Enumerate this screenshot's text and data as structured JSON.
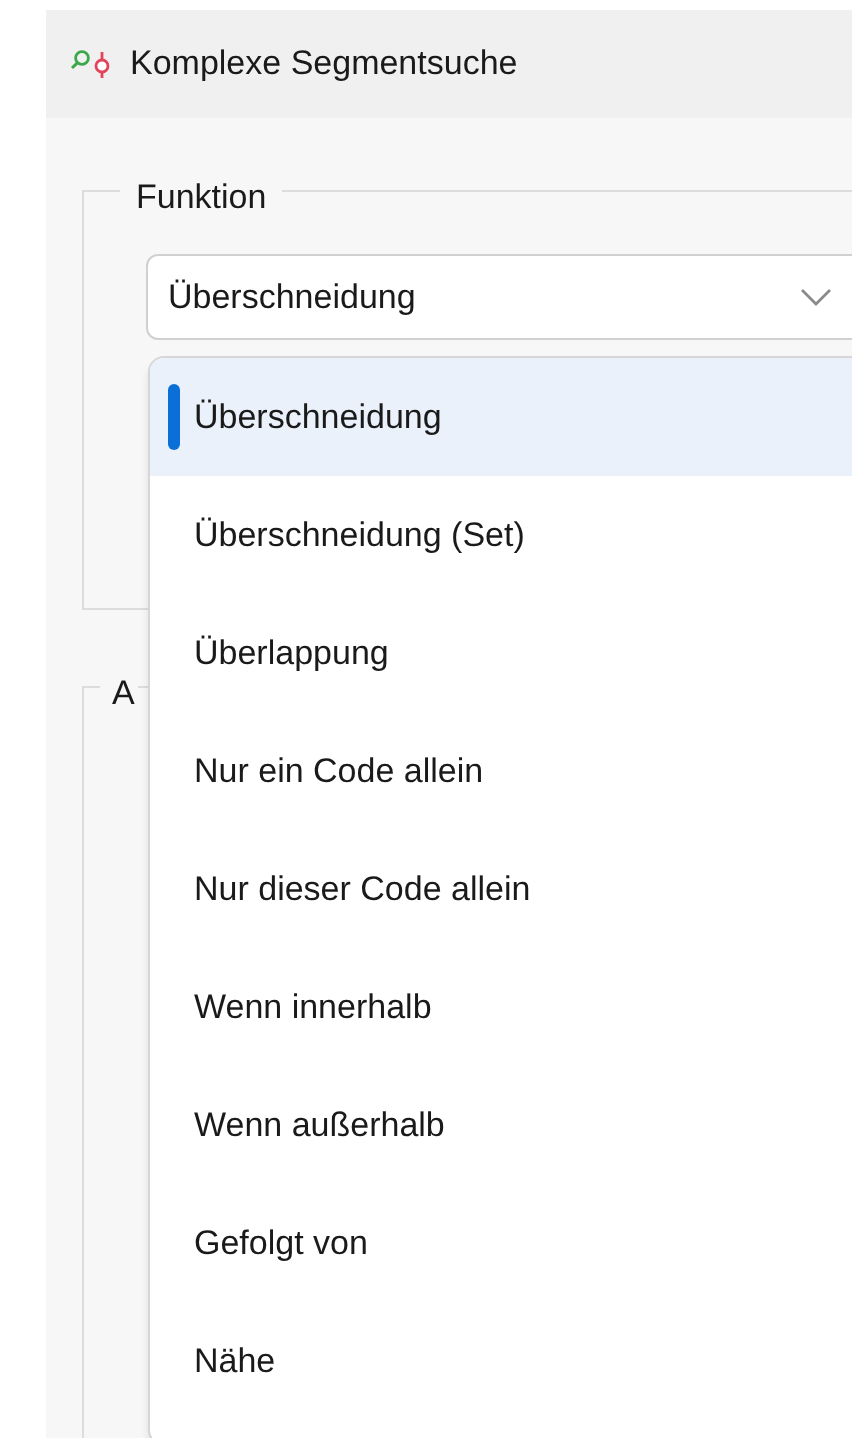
{
  "window": {
    "title": "Komplexe Segmentsuche"
  },
  "function_group": {
    "label": "Funktion",
    "combobox": {
      "value": "Überschneidung",
      "expanded": true
    }
  },
  "second_group": {
    "label": "A"
  },
  "dropdown": [
    {
      "label": "Überschneidung",
      "selected": true
    },
    {
      "label": "Überschneidung (Set)",
      "selected": false
    },
    {
      "label": "Überlappung",
      "selected": false
    },
    {
      "label": "Nur ein Code allein",
      "selected": false
    },
    {
      "label": "Nur dieser Code allein",
      "selected": false
    },
    {
      "label": "Wenn innerhalb",
      "selected": false
    },
    {
      "label": "Wenn außerhalb",
      "selected": false
    },
    {
      "label": "Gefolgt von",
      "selected": false
    },
    {
      "label": "Nähe",
      "selected": false
    }
  ]
}
